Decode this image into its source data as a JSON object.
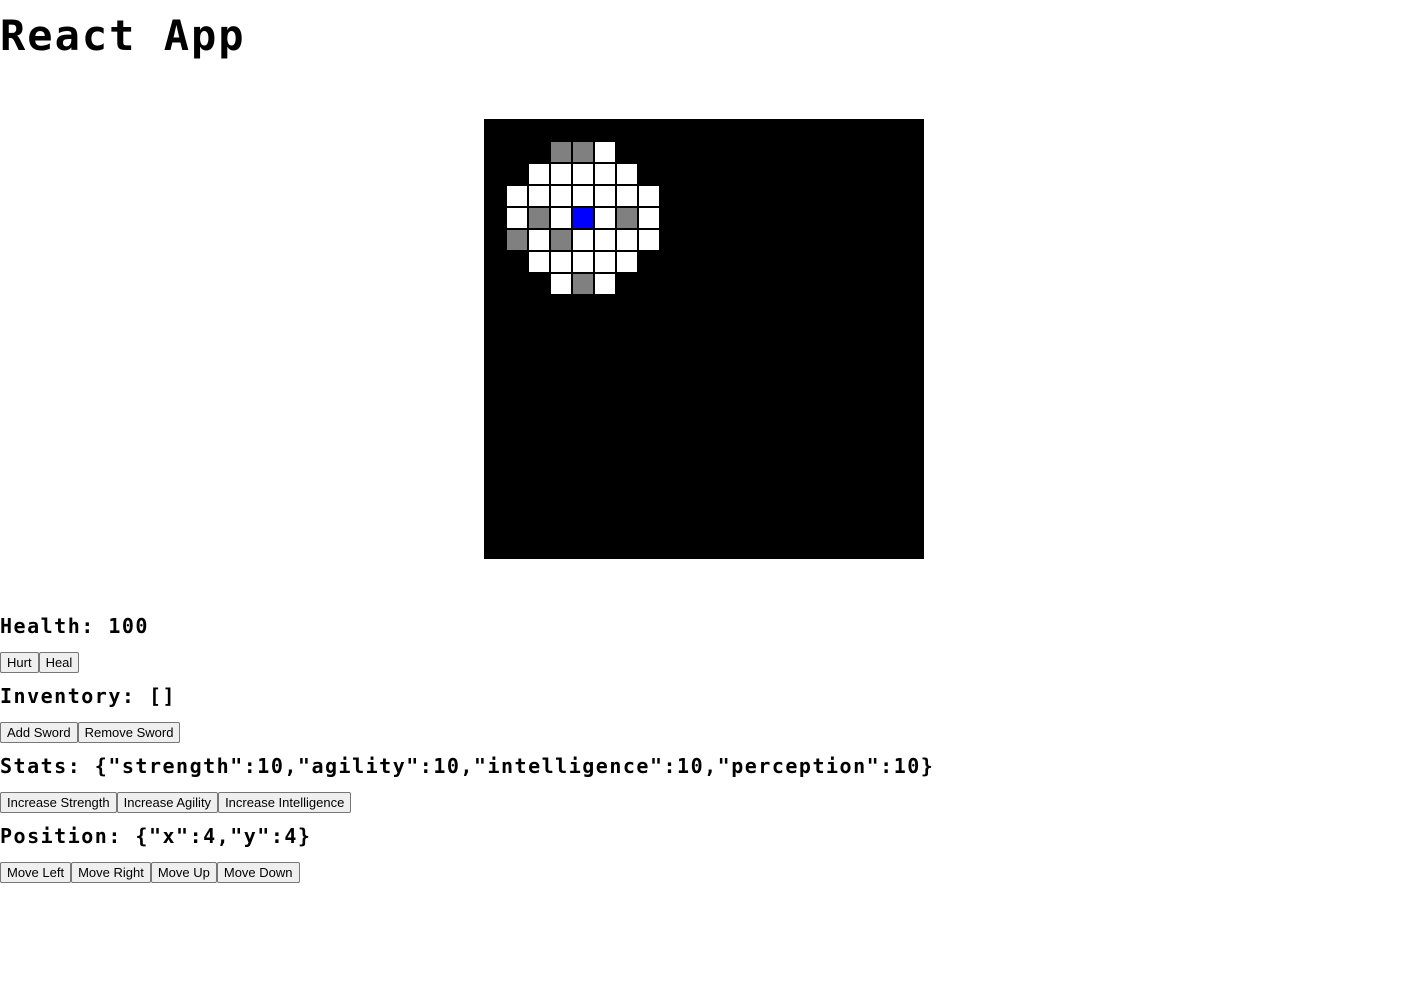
{
  "header": {
    "title": "React App"
  },
  "game": {
    "colors": {
      "board": "#000000",
      "floor": "#ffffff",
      "wall": "#808080",
      "player": "#0000ff"
    },
    "tiles": [
      {
        "c": 3,
        "r": 1,
        "t": "wall"
      },
      {
        "c": 4,
        "r": 1,
        "t": "wall"
      },
      {
        "c": 5,
        "r": 1,
        "t": "floor"
      },
      {
        "c": 2,
        "r": 2,
        "t": "floor"
      },
      {
        "c": 3,
        "r": 2,
        "t": "floor"
      },
      {
        "c": 4,
        "r": 2,
        "t": "floor"
      },
      {
        "c": 5,
        "r": 2,
        "t": "floor"
      },
      {
        "c": 6,
        "r": 2,
        "t": "floor"
      },
      {
        "c": 1,
        "r": 3,
        "t": "floor"
      },
      {
        "c": 2,
        "r": 3,
        "t": "floor"
      },
      {
        "c": 3,
        "r": 3,
        "t": "floor"
      },
      {
        "c": 4,
        "r": 3,
        "t": "floor"
      },
      {
        "c": 5,
        "r": 3,
        "t": "floor"
      },
      {
        "c": 6,
        "r": 3,
        "t": "floor"
      },
      {
        "c": 7,
        "r": 3,
        "t": "floor"
      },
      {
        "c": 1,
        "r": 4,
        "t": "floor"
      },
      {
        "c": 2,
        "r": 4,
        "t": "wall"
      },
      {
        "c": 3,
        "r": 4,
        "t": "floor"
      },
      {
        "c": 4,
        "r": 4,
        "t": "player"
      },
      {
        "c": 5,
        "r": 4,
        "t": "floor"
      },
      {
        "c": 6,
        "r": 4,
        "t": "wall"
      },
      {
        "c": 7,
        "r": 4,
        "t": "floor"
      },
      {
        "c": 1,
        "r": 5,
        "t": "wall"
      },
      {
        "c": 2,
        "r": 5,
        "t": "floor"
      },
      {
        "c": 3,
        "r": 5,
        "t": "wall"
      },
      {
        "c": 4,
        "r": 5,
        "t": "floor"
      },
      {
        "c": 5,
        "r": 5,
        "t": "floor"
      },
      {
        "c": 6,
        "r": 5,
        "t": "floor"
      },
      {
        "c": 7,
        "r": 5,
        "t": "floor"
      },
      {
        "c": 2,
        "r": 6,
        "t": "floor"
      },
      {
        "c": 3,
        "r": 6,
        "t": "floor"
      },
      {
        "c": 4,
        "r": 6,
        "t": "floor"
      },
      {
        "c": 5,
        "r": 6,
        "t": "floor"
      },
      {
        "c": 6,
        "r": 6,
        "t": "floor"
      },
      {
        "c": 3,
        "r": 7,
        "t": "floor"
      },
      {
        "c": 4,
        "r": 7,
        "t": "wall"
      },
      {
        "c": 5,
        "r": 7,
        "t": "floor"
      }
    ]
  },
  "health": {
    "text": "Health: 100",
    "hurt_label": "Hurt",
    "heal_label": "Heal"
  },
  "inventory": {
    "text": "Inventory: []",
    "add_label": "Add Sword",
    "remove_label": "Remove Sword"
  },
  "stats": {
    "text": "Stats: {\"strength\":10,\"agility\":10,\"intelligence\":10,\"perception\":10}",
    "strength_label": "Increase Strength",
    "agility_label": "Increase Agility",
    "intelligence_label": "Increase Intelligence"
  },
  "position": {
    "text": "Position: {\"x\":4,\"y\":4}",
    "left_label": "Move Left",
    "right_label": "Move Right",
    "up_label": "Move Up",
    "down_label": "Move Down"
  }
}
